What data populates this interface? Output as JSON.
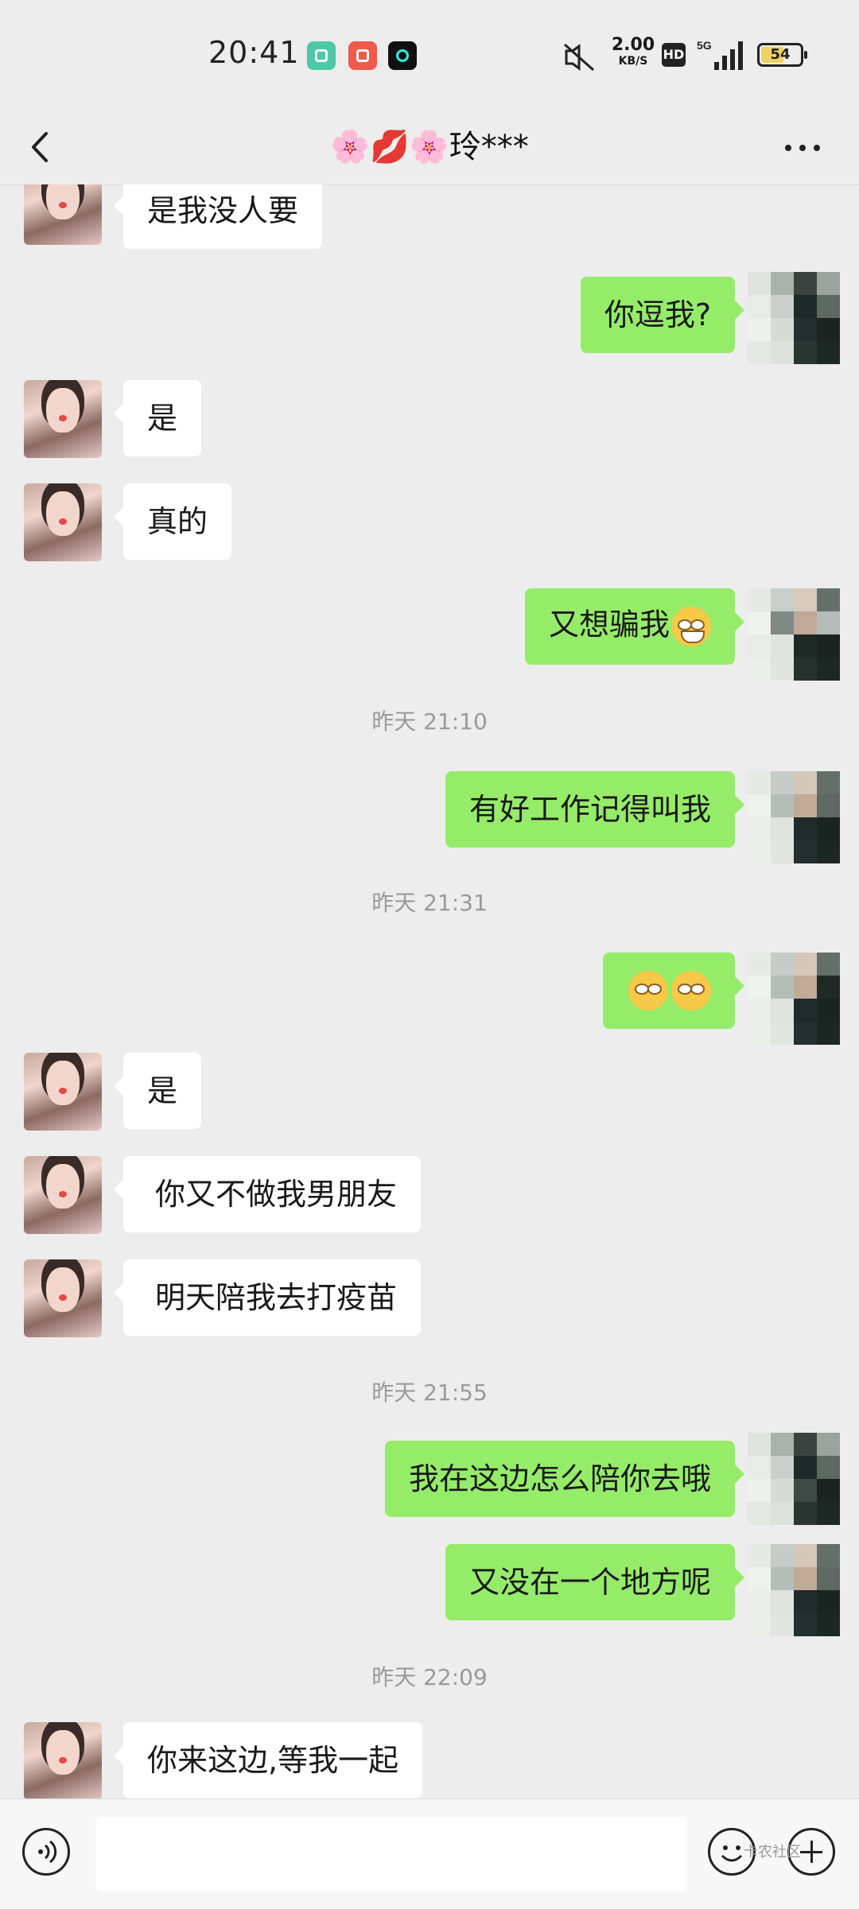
{
  "status_bar": {
    "time": "20:41",
    "net_speed_value": "2.00",
    "net_speed_unit": "KB/S",
    "hd": "HD",
    "network": "5G",
    "battery": "54"
  },
  "nav": {
    "title": "🌸💋🌸玲***"
  },
  "chat": {
    "messages": [
      {
        "side": "left",
        "text": "是我没人要"
      },
      {
        "side": "right",
        "text": "你逗我?"
      },
      {
        "side": "left",
        "text": "是"
      },
      {
        "side": "left",
        "text": "真的"
      },
      {
        "side": "right",
        "text": "又想骗我",
        "emoji": "grin-emoji"
      },
      {
        "side": "time",
        "text": "昨天 21:10"
      },
      {
        "side": "right",
        "text": "有好工作记得叫我"
      },
      {
        "side": "time",
        "text": "昨天 21:31"
      },
      {
        "side": "right",
        "text": "",
        "emoji": "flushed-emoji-pair"
      },
      {
        "side": "left",
        "text": "是"
      },
      {
        "side": "left",
        "text": "你又不做我男朋友"
      },
      {
        "side": "left",
        "text": "明天陪我去打疫苗"
      },
      {
        "side": "time",
        "text": "昨天 21:55"
      },
      {
        "side": "right",
        "text": "我在这边怎么陪你去哦"
      },
      {
        "side": "right",
        "text": "又没在一个地方呢"
      },
      {
        "side": "time",
        "text": "昨天 22:09"
      },
      {
        "side": "left",
        "text": "你来这边,等我一起"
      }
    ]
  },
  "bottom": {
    "watermark": "卡农社区"
  },
  "colors": {
    "background": "#ededed",
    "bubble_sent": "#95ec69",
    "bubble_received": "#ffffff",
    "timestamp": "#9a9a9a"
  }
}
